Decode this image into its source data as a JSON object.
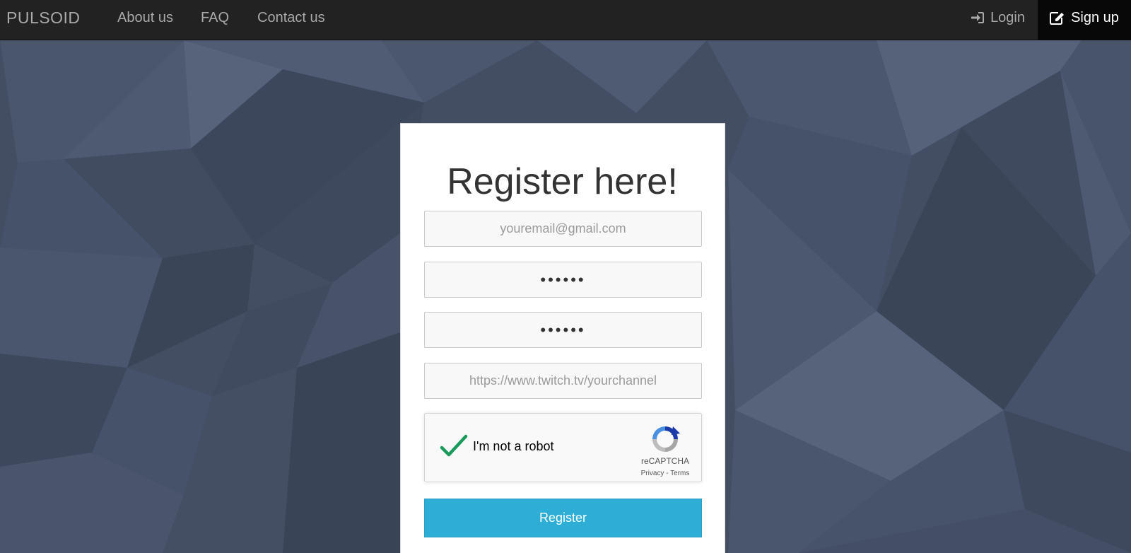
{
  "navbar": {
    "brand": "PULSOID",
    "links": [
      {
        "label": "About us"
      },
      {
        "label": "FAQ"
      },
      {
        "label": "Contact us"
      }
    ],
    "login_label": "Login",
    "signup_label": "Sign up"
  },
  "form": {
    "title": "Register here!",
    "email_placeholder": "youremail@gmail.com",
    "password_value": "••••••",
    "confirm_password_value": "••••••",
    "twitch_placeholder": "https://www.twitch.tv/yourchannel",
    "captcha": {
      "label": "I'm not a robot",
      "brand": "reCAPTCHA",
      "privacy": "Privacy",
      "separator": " - ",
      "terms": "Terms",
      "checked": true
    },
    "register_label": "Register"
  },
  "colors": {
    "navbar_bg": "#222222",
    "signup_bg": "#080808",
    "background": "#434e63",
    "register_button": "#2eaed6",
    "checkmark": "#1a9a5b"
  },
  "icons": {
    "login": "sign-in-icon",
    "signup": "pencil-square-icon",
    "captcha_check": "checkmark-icon",
    "captcha_logo": "recaptcha-logo"
  }
}
